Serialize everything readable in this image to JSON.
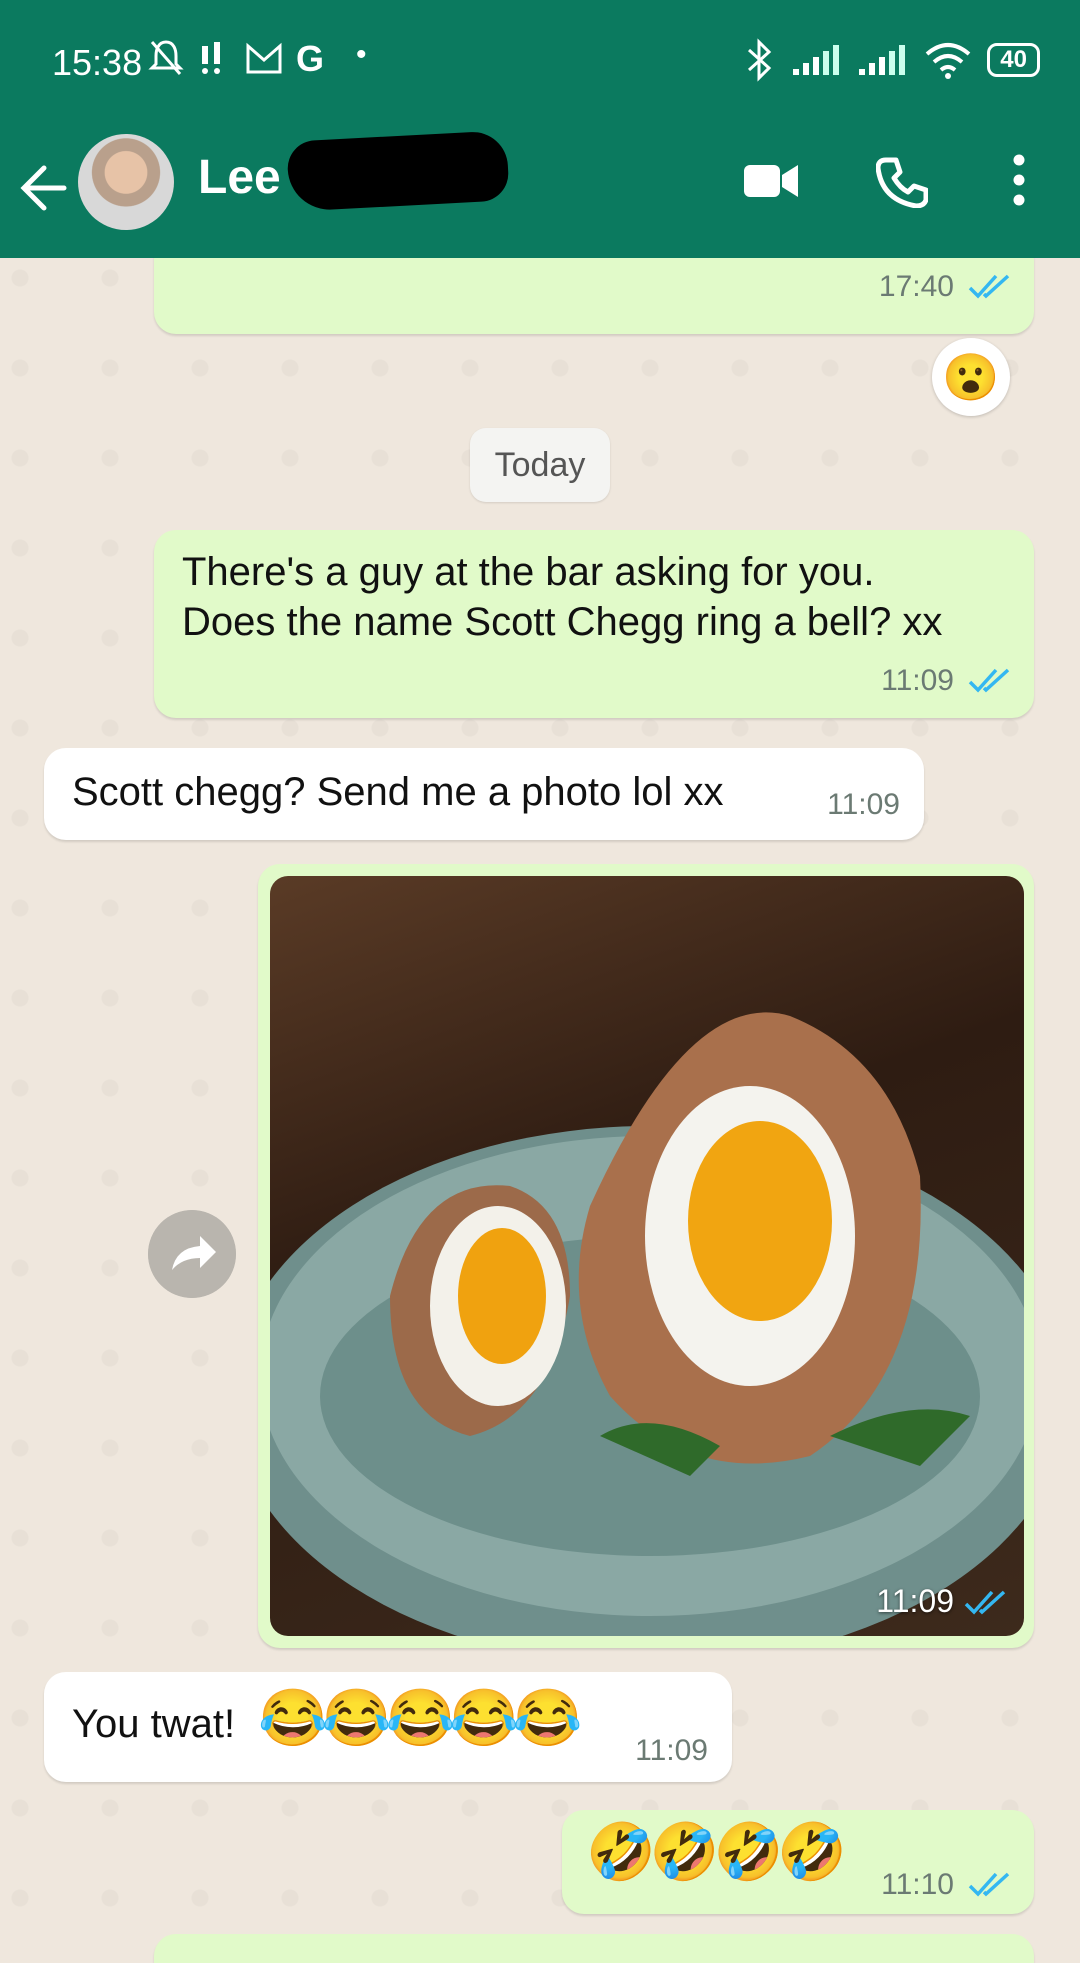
{
  "status_bar": {
    "time": "15:38",
    "battery": "40"
  },
  "header": {
    "contact_name": "Lee"
  },
  "chat": {
    "prev_message_time": "17:40",
    "prev_reaction": "😮",
    "day_separator": "Today",
    "messages": [
      {
        "direction": "out",
        "text_line1": "There's a guy at the bar asking for you.",
        "text_line2": "Does the name Scott Chegg ring a bell? xx",
        "time": "11:09",
        "read": true
      },
      {
        "direction": "in",
        "text": "Scott chegg? Send me a photo lol xx",
        "time": "11:09"
      },
      {
        "direction": "out",
        "type": "image",
        "image_subject": "scotch eggs in a bowl",
        "time": "11:09",
        "read": true
      },
      {
        "direction": "in",
        "text": "You twat! ",
        "emojis": "😂😂😂😂😂",
        "time": "11:09"
      },
      {
        "direction": "out",
        "emojis": "🤣🤣🤣🤣",
        "time": "11:10",
        "read": true
      }
    ]
  },
  "colors": {
    "header_bg": "#0b7a5f",
    "outgoing_bubble": "#e1fac9",
    "incoming_bubble": "#ffffff",
    "chat_bg": "#efe7dd",
    "read_ticks": "#34b7f1"
  },
  "icons": [
    "back-arrow-icon",
    "video-call-icon",
    "phone-call-icon",
    "more-vert-icon",
    "forward-icon",
    "bluetooth-icon",
    "signal-icon",
    "wifi-icon",
    "mute-icon",
    "gmail-icon",
    "google-icon"
  ]
}
